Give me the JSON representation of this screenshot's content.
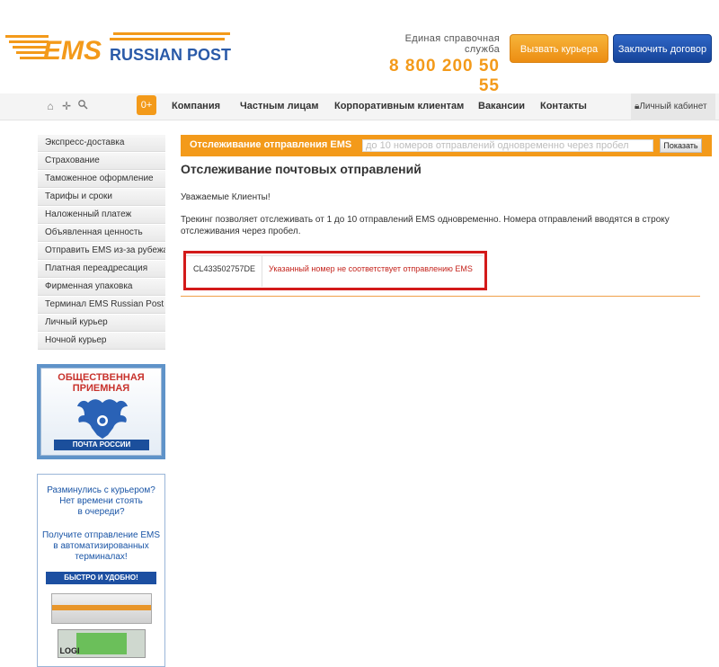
{
  "header": {
    "logo_ems": "EMS",
    "logo_text": "RUSSIAN POST",
    "hotline_label": "Единая справочная служба",
    "hotline_phone": "8 800 200 50 55",
    "courier_button": "Вызвать курьера",
    "contract_button": "Заключить договор"
  },
  "nav": {
    "icons": [
      "home-icon",
      "sitemap-icon",
      "search-icon"
    ],
    "age_badge": "0+",
    "items": [
      "Компания",
      "Частным лицам",
      "Корпоративным клиентам",
      "Вакансии",
      "Контакты"
    ],
    "cabinet": "Личный кабинет"
  },
  "sidebar": {
    "items": [
      "Экспресс-доставка",
      "Страхование",
      "Таможенное оформление",
      "Тарифы и сроки",
      "Наложенный платеж",
      "Объявленная ценность",
      "Отправить EMS из-за рубежа",
      "Платная переадресация",
      "Фирменная упаковка",
      "Терминал EMS Russian Post",
      "Личный курьер",
      "Ночной курьер"
    ]
  },
  "banners": {
    "reception_title_1": "ОБЩЕСТВЕННАЯ",
    "reception_title_2": "ПРИЕМНАЯ",
    "reception_footer": "ПОЧТА РОССИИ",
    "terminal_text_1a": "Разминулись с курьером?",
    "terminal_text_1b": "Нет времени стоять",
    "terminal_text_1c": "в очереди?",
    "terminal_text_2a": "Получите отправление EMS",
    "terminal_text_2b": "в автоматизированных",
    "terminal_text_2c": "терминалах!",
    "terminal_strip": "БЫСТРО И УДОБНО!",
    "terminal_brand": "LOGI"
  },
  "tracking": {
    "bar_label": "Отслеживание отправления EMS",
    "input_placeholder": "до 10 номеров отправлений одновременно через пробел",
    "submit_label": "Показать",
    "page_title": "Отслеживание почтовых отправлений",
    "greeting": "Уважаемые Клиенты!",
    "intro": "Трекинг позволяет отслеживать от 1 до 10 отправлений EMS одновременно. Номера отправлений вводятся в строку отслеживания через пробел.",
    "result": {
      "code": "CL433502757DE",
      "message": "Указанный номер не соответствует отправлению EMS"
    }
  },
  "colors": {
    "brand_orange": "#f39a1a",
    "brand_blue": "#16449a",
    "error_red": "#c4241d",
    "highlight_red": "#d31a1a"
  }
}
